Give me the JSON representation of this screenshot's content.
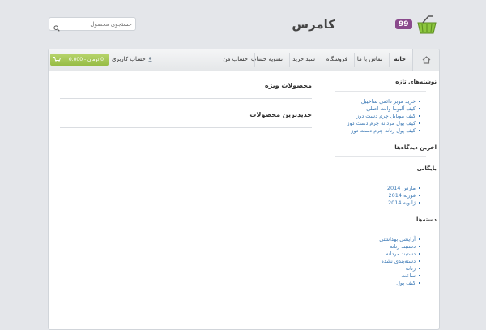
{
  "search": {
    "placeholder": "جستجوی محصول"
  },
  "logo": {
    "brand": "کامرس",
    "badge": "99"
  },
  "nav": {
    "items": [
      "خانه",
      "تماس با ما",
      "فروشگاه",
      "سبد خرید",
      "تسویه حساب",
      "حساب من"
    ],
    "account_label": "حساب کاربری",
    "cart_text": "0 تومان - 0.000"
  },
  "content": {
    "featured_title": "محصولات ویژه",
    "latest_title": "جدیدترین محصولات"
  },
  "sidebar": {
    "recent_posts": {
      "title": "نوشته‌های تازه",
      "items": [
        "خرید موبر دائمی ساخیبل",
        "کیف آلبوما والت اصلی",
        "کیف موبایل چرم دست دوز",
        "کیف پول مردانه چرم دست دوز",
        "کیف پول زنانه چرم دست دوز"
      ]
    },
    "recent_comments": {
      "title": "آخرین دیدگاه‌ها"
    },
    "archives": {
      "title": "بایگانی",
      "items": [
        "مارس 2014",
        "فوریه 2014",
        "ژانویه 2014"
      ]
    },
    "categories": {
      "title": "دسته‌ها",
      "items": [
        "آرایشی بهداشتی",
        "دستبند زنانه",
        "دستبند مردانه",
        "دسته‌بندی نشده",
        "زنانه",
        "ساعت",
        "کیف پول"
      ]
    }
  }
}
